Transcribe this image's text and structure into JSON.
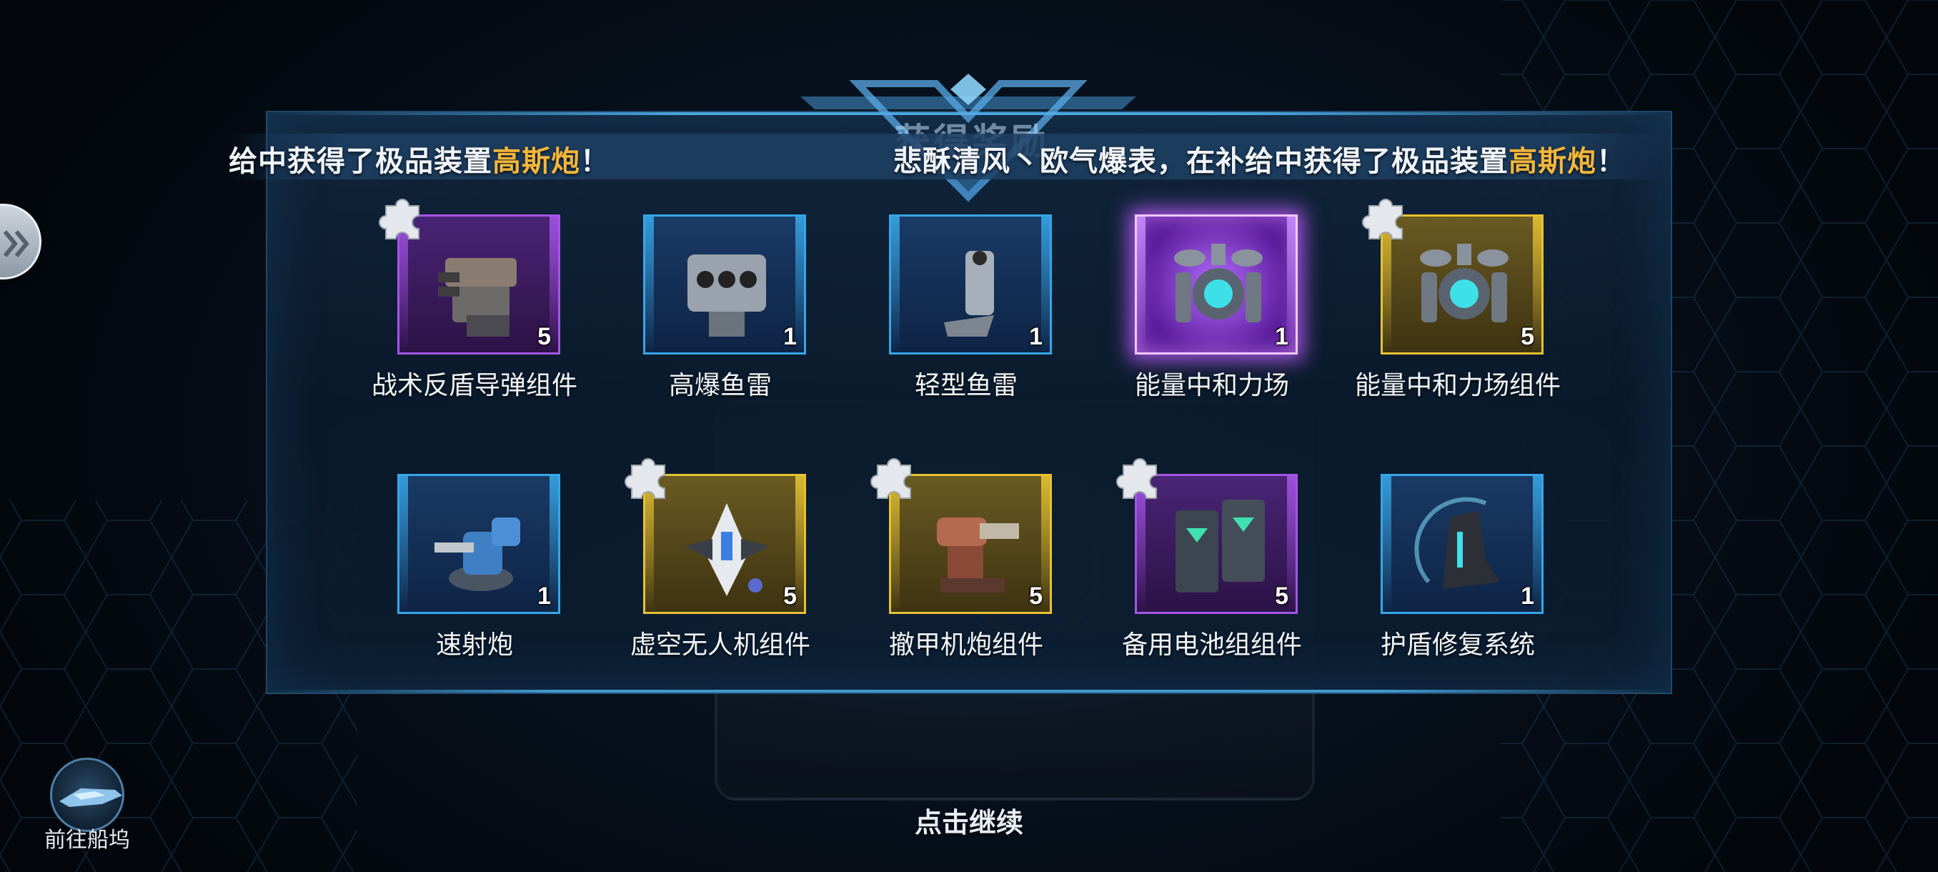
{
  "header": {
    "title": "获得奖励"
  },
  "broadcast": [
    {
      "parts": [
        {
          "text": "给中获得了极品装置",
          "hl": false
        },
        {
          "text": "高斯炮",
          "hl": true
        },
        {
          "text": "！",
          "hl": false
        }
      ]
    },
    {
      "parts": [
        {
          "text": "悲酥清风丶欧气爆表，在补给中获得了极品装置",
          "hl": false
        },
        {
          "text": "高斯炮",
          "hl": true
        },
        {
          "text": "！",
          "hl": false
        }
      ]
    }
  ],
  "items": [
    {
      "name": "战术反盾导弹组件",
      "qty": "5",
      "rarity": "purple",
      "fragment": true,
      "icon": "missile-turret-icon"
    },
    {
      "name": "高爆鱼雷",
      "qty": "1",
      "rarity": "blue",
      "fragment": false,
      "icon": "torpedo-launcher-icon"
    },
    {
      "name": "轻型鱼雷",
      "qty": "1",
      "rarity": "blue",
      "fragment": false,
      "icon": "light-torpedo-icon"
    },
    {
      "name": "能量中和力场",
      "qty": "1",
      "rarity": "purple-glow",
      "fragment": false,
      "icon": "energy-field-generator-icon"
    },
    {
      "name": "能量中和力场组件",
      "qty": "5",
      "rarity": "gold",
      "fragment": true,
      "icon": "energy-field-generator-icon"
    },
    {
      "name": "速射炮",
      "qty": "1",
      "rarity": "blue",
      "fragment": false,
      "icon": "rapid-cannon-icon"
    },
    {
      "name": "虚空无人机组件",
      "qty": "5",
      "rarity": "gold",
      "fragment": true,
      "icon": "drone-icon"
    },
    {
      "name": "撤甲机炮组件",
      "qty": "5",
      "rarity": "gold",
      "fragment": true,
      "icon": "autocannon-icon"
    },
    {
      "name": "备用电池组组件",
      "qty": "5",
      "rarity": "purple",
      "fragment": true,
      "icon": "battery-pack-icon"
    },
    {
      "name": "护盾修复系统",
      "qty": "1",
      "rarity": "blue",
      "fragment": false,
      "icon": "shield-repair-icon"
    }
  ],
  "footer": {
    "continue_label": "点击继续",
    "dock_label": "前往船坞"
  },
  "colors": {
    "blue": "#36a6e6",
    "purple": "#a654e8",
    "gold": "#e6c232",
    "highlight": "#f3b63a"
  }
}
